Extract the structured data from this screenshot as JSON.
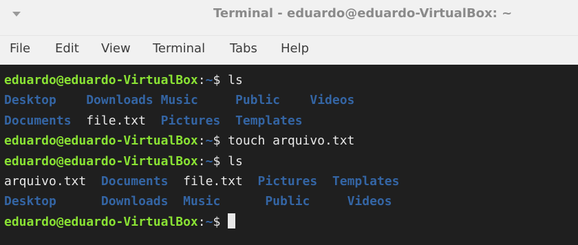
{
  "window": {
    "title": "Terminal - eduardo@eduardo-VirtualBox: ~"
  },
  "menu": {
    "icon": "chevron-down-icon",
    "items": [
      "File",
      "Edit",
      "View",
      "Terminal",
      "Tabs",
      "Help"
    ]
  },
  "terminal": {
    "prompt_user": "eduardo@eduardo-VirtualBox",
    "prompt_colon": ":",
    "prompt_path": "~",
    "prompt_dollar": "$ ",
    "lines": [
      {
        "type": "prompt",
        "command": "ls"
      },
      {
        "type": "listing",
        "entries": [
          {
            "name": "Desktop",
            "kind": "dir",
            "pad": "    "
          },
          {
            "name": "Downloads",
            "kind": "dir",
            "pad": " "
          },
          {
            "name": "Music",
            "kind": "dir",
            "pad": "     "
          },
          {
            "name": "Public",
            "kind": "dir",
            "pad": "    "
          },
          {
            "name": "Videos",
            "kind": "dir",
            "pad": ""
          }
        ]
      },
      {
        "type": "listing",
        "entries": [
          {
            "name": "Documents",
            "kind": "dir",
            "pad": "  "
          },
          {
            "name": "file.txt",
            "kind": "file",
            "pad": "  "
          },
          {
            "name": "Pictures",
            "kind": "dir",
            "pad": "  "
          },
          {
            "name": "Templates",
            "kind": "dir",
            "pad": ""
          }
        ]
      },
      {
        "type": "prompt",
        "command": "touch arquivo.txt"
      },
      {
        "type": "prompt",
        "command": "ls"
      },
      {
        "type": "listing",
        "entries": [
          {
            "name": "arquivo.txt",
            "kind": "file",
            "pad": "  "
          },
          {
            "name": "Documents",
            "kind": "dir",
            "pad": "  "
          },
          {
            "name": "file.txt",
            "kind": "file",
            "pad": "  "
          },
          {
            "name": "Pictures",
            "kind": "dir",
            "pad": "  "
          },
          {
            "name": "Templates",
            "kind": "dir",
            "pad": ""
          }
        ]
      },
      {
        "type": "listing",
        "entries": [
          {
            "name": "Desktop",
            "kind": "dir",
            "pad": "      "
          },
          {
            "name": "Downloads",
            "kind": "dir",
            "pad": "  "
          },
          {
            "name": "Music",
            "kind": "dir",
            "pad": "      "
          },
          {
            "name": "Public",
            "kind": "dir",
            "pad": "     "
          },
          {
            "name": "Videos",
            "kind": "dir",
            "pad": ""
          }
        ]
      },
      {
        "type": "prompt",
        "command": "",
        "cursor": true
      }
    ]
  },
  "colors": {
    "prompt_user": "#8ae234",
    "directory": "#3465a4",
    "text": "#e8e8e8",
    "background": "#1f1f1f",
    "titlebar": "#f1f1f1"
  }
}
